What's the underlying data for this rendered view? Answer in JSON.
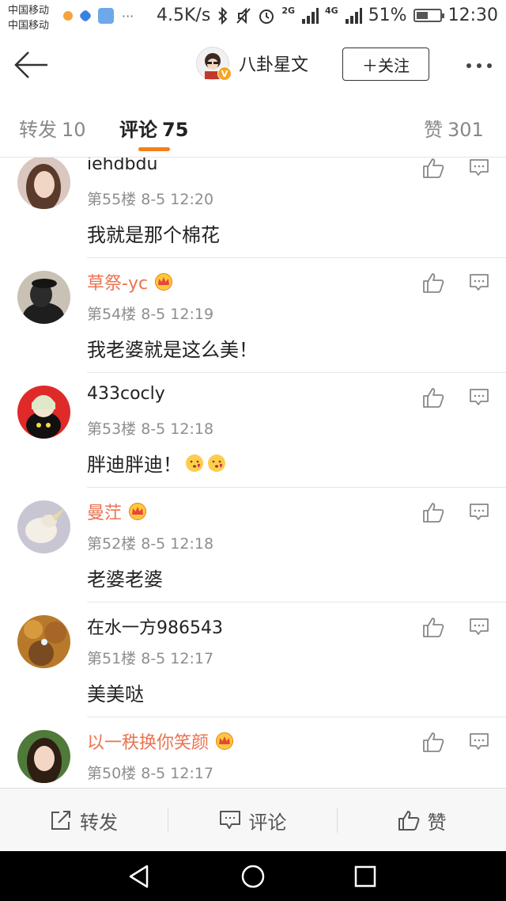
{
  "status": {
    "carrier1": "中国移动",
    "carrier2": "中国移动",
    "speed": "4.5K/s",
    "net2g": "2G",
    "net4g": "4G",
    "battery": "51%",
    "battery_level": 0.51,
    "time": "12:30"
  },
  "header": {
    "name": "八卦星文",
    "verified_mark": "V",
    "follow_label": "＋关注"
  },
  "tabs": {
    "repost_label": "转发",
    "repost_count": "10",
    "comment_label": "评论",
    "comment_count": "75",
    "like_label": "赞",
    "like_count": "301"
  },
  "comments": [
    {
      "user": "iehdbdu",
      "floor": "第55楼",
      "time": "8-5 12:20",
      "text": "我就是那个棉花",
      "vip": false,
      "emojis": 0
    },
    {
      "user": "草祭-yc",
      "floor": "第54楼",
      "time": "8-5 12:19",
      "text": "我老婆就是这么美！",
      "vip": true,
      "emojis": 0
    },
    {
      "user": "433cocly",
      "floor": "第53楼",
      "time": "8-5 12:18",
      "text": "胖迪胖迪！",
      "vip": false,
      "emojis": 2
    },
    {
      "user": "曼茳",
      "floor": "第52楼",
      "time": "8-5 12:18",
      "text": "老婆老婆",
      "vip": true,
      "emojis": 0
    },
    {
      "user": "在水一方986543",
      "floor": "第51楼",
      "time": "8-5 12:17",
      "text": "美美哒",
      "vip": false,
      "emojis": 0
    },
    {
      "user": "以一秩换你笑颜",
      "floor": "第50楼",
      "time": "8-5 12:17",
      "text": "",
      "vip": true,
      "emojis": 0
    }
  ],
  "bottom": {
    "repost_label": "转发",
    "comment_label": "评论",
    "like_label": "赞"
  },
  "colors": {
    "accent": "#f47f1b",
    "vip_name": "#eb7350"
  }
}
